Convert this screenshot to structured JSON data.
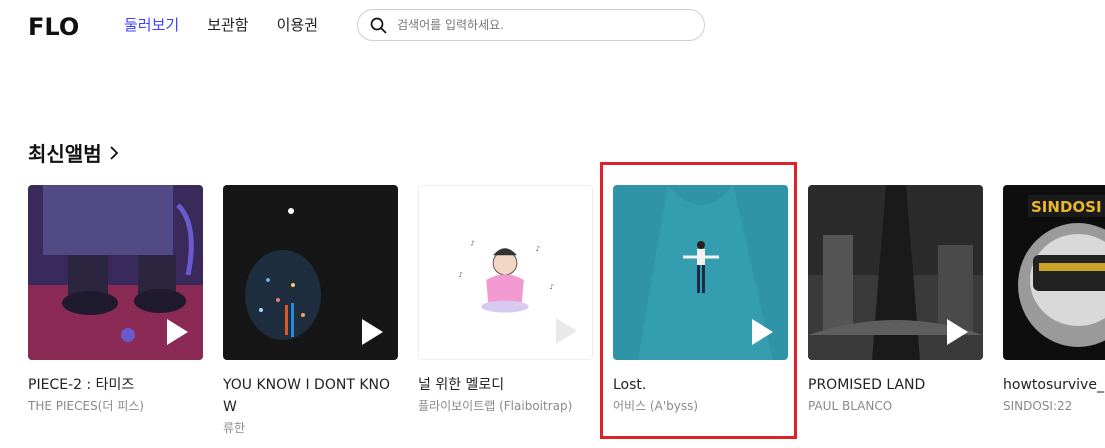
{
  "app": {
    "logo": "FLO"
  },
  "nav": {
    "items": [
      {
        "label": "둘러보기",
        "active": true
      },
      {
        "label": "보관함"
      },
      {
        "label": "이용권"
      }
    ]
  },
  "search": {
    "placeholder": "검색어를 입력하세요."
  },
  "section": {
    "title": "최신앨범"
  },
  "albums": [
    {
      "title": "PIECE-2 : 타미즈",
      "artist": "THE PIECES(더 피스)"
    },
    {
      "title": "YOU KNOW I DONT KNOW",
      "artist": "류한"
    },
    {
      "title": "널 위한 멜로디",
      "artist": "플라이보이트랩 (Flaiboitrap)"
    },
    {
      "title": "Lost.",
      "artist": "어비스 (A'byss)"
    },
    {
      "title": "PROMISED LAND",
      "artist": "PAUL BLANCO"
    },
    {
      "title": "howtosurvive_",
      "artist": "SINDOSI:22"
    }
  ],
  "colors": {
    "accent": "#3f3fff",
    "highlight": "#e0202b"
  }
}
